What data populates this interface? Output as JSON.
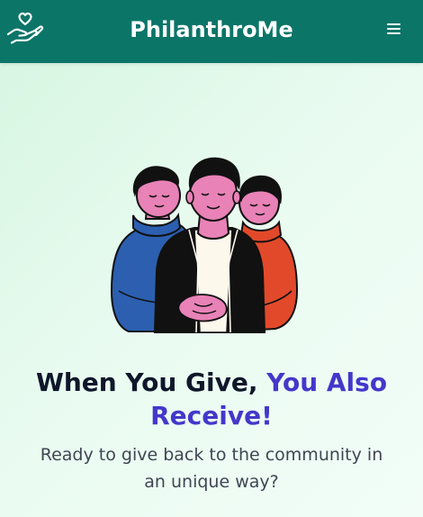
{
  "header": {
    "brand": "PhilanthroMe",
    "logo_icon": "heart-in-hand-icon",
    "menu_icon": "hamburger-menu-icon"
  },
  "hero": {
    "illustration": "three-people-hugging-illustration",
    "headline_part1": "When You Give, ",
    "headline_part2": "You Also Receive!",
    "subtext": "Ready to give back to the community in an unique way?"
  },
  "colors": {
    "header_bg": "#0b7568",
    "accent": "#4338ca",
    "headline": "#0f172a",
    "subtext": "#3f4652"
  }
}
